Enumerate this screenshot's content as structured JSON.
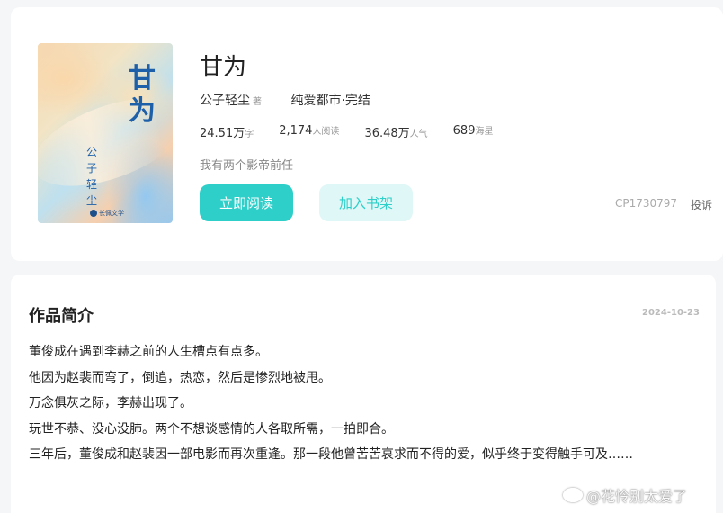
{
  "book": {
    "cover_title": "甘为",
    "cover_author": "公子轻尘",
    "cover_publisher": "长佩文学",
    "title": "甘为",
    "author": "公子轻尘",
    "author_suffix": "著",
    "category": "纯爱都市·完结",
    "stats": [
      {
        "value": "24.51万",
        "unit": "字"
      },
      {
        "value": "2,174",
        "unit": "人阅读"
      },
      {
        "value": "36.48万",
        "unit": "人气"
      },
      {
        "value": "689",
        "unit": "海星"
      }
    ],
    "tagline": "我有两个影帝前任",
    "read_label": "立即阅读",
    "shelf_label": "加入书架",
    "cp_code": "CP1730797",
    "report_label": "投诉"
  },
  "synopsis": {
    "title": "作品简介",
    "date": "2024-10-23",
    "paragraphs": [
      "董俊成在遇到李赫之前的人生槽点有点多。",
      "他因为赵裴而弯了，倒追，热恋，然后是惨烈地被甩。",
      "万念俱灰之际，李赫出现了。",
      "玩世不恭、没心没肺。两个不想谈感情的人各取所需，一拍即合。",
      "三年后，董俊成和赵裴因一部电影而再次重逢。那一段他曾苦苦哀求而不得的爱，似乎终于变得触手可及……"
    ]
  },
  "watermark": "@花怜别太爱了",
  "colors": {
    "accent": "#2ecfc9",
    "accent_light": "#dff7f6",
    "cover_title": "#1d5fa8"
  }
}
